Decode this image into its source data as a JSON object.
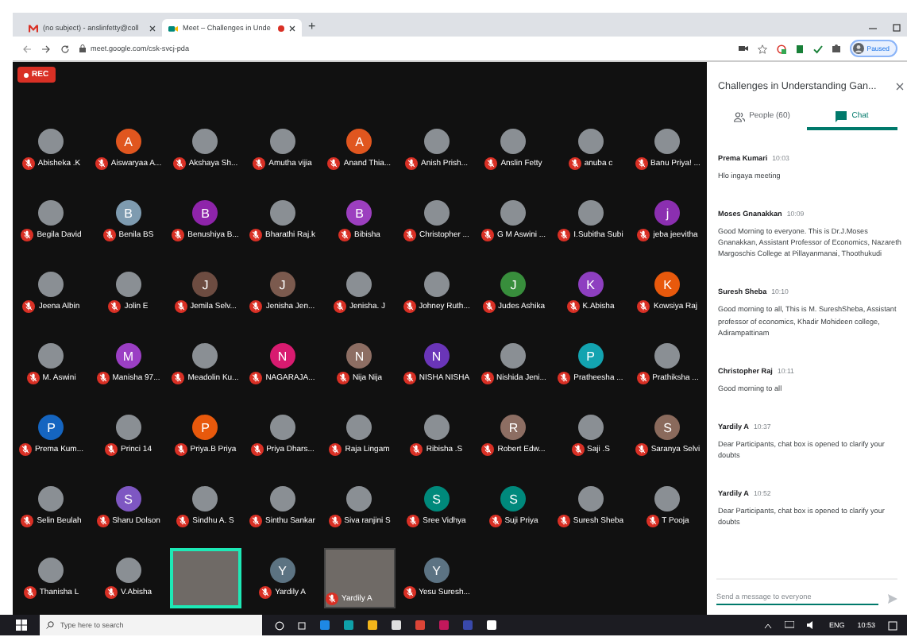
{
  "browser": {
    "tabs": [
      {
        "title": "(no subject) - anslinfetty@coll",
        "kind": "mail",
        "selected": false,
        "recording": false
      },
      {
        "title": "Meet – Challenges in Unde",
        "kind": "meet",
        "selected": true,
        "recording": true
      }
    ],
    "new_tab": "+",
    "url": "meet.google.com/csk-svcj-pda",
    "profile": "Paused"
  },
  "meeting": {
    "rec_badge": "REC",
    "participants": [
      {
        "name": "Abisheka .K",
        "kind": "photo",
        "muted": true
      },
      {
        "name": "Aiswaryaa A...",
        "kind": "letter",
        "letter": "A",
        "color": "#e0561f",
        "muted": true
      },
      {
        "name": "Akshaya Sh...",
        "kind": "photo",
        "muted": true
      },
      {
        "name": "Amutha vijia",
        "kind": "photo",
        "muted": true
      },
      {
        "name": "Anand Thia...",
        "kind": "letter",
        "letter": "A",
        "color": "#e0561f",
        "muted": true
      },
      {
        "name": "Anish Prish...",
        "kind": "photo",
        "muted": true
      },
      {
        "name": "Anslin Fetty",
        "kind": "photo",
        "muted": true
      },
      {
        "name": "anuba c",
        "kind": "photo",
        "muted": true
      },
      {
        "name": "Banu Priya! ...",
        "kind": "photo",
        "muted": true
      },
      {
        "name": "Begila David",
        "kind": "photo",
        "muted": true
      },
      {
        "name": "Benila BS",
        "kind": "letter",
        "letter": "B",
        "color": "#7e9bb0",
        "muted": true
      },
      {
        "name": "Benushiya B...",
        "kind": "letter",
        "letter": "B",
        "color": "#8e24aa",
        "muted": true
      },
      {
        "name": "Bharathi Raj.k",
        "kind": "photo",
        "muted": true
      },
      {
        "name": "Bibisha",
        "kind": "letter",
        "letter": "B",
        "color": "#9c3fbf",
        "muted": true
      },
      {
        "name": "Christopher ...",
        "kind": "photo",
        "muted": true
      },
      {
        "name": "G M Aswini ...",
        "kind": "photo",
        "muted": true
      },
      {
        "name": "I.Subitha Subi",
        "kind": "photo",
        "muted": true
      },
      {
        "name": "jeba jeevitha",
        "kind": "letter",
        "letter": "j",
        "color": "#8b2fb0",
        "muted": true
      },
      {
        "name": "Jeena Albin",
        "kind": "photo",
        "muted": true
      },
      {
        "name": "Jolin E",
        "kind": "photo",
        "muted": true
      },
      {
        "name": "Jemila Selv...",
        "kind": "letter",
        "letter": "J",
        "color": "#6d4c41",
        "muted": true
      },
      {
        "name": "Jenisha Jen...",
        "kind": "letter",
        "letter": "J",
        "color": "#7b5a4e",
        "muted": true
      },
      {
        "name": "Jenisha. J",
        "kind": "photo",
        "muted": true
      },
      {
        "name": "Johney Ruth...",
        "kind": "photo",
        "muted": true
      },
      {
        "name": "Judes Ashika",
        "kind": "letter",
        "letter": "J",
        "color": "#388e3c",
        "muted": true
      },
      {
        "name": "K.Abisha",
        "kind": "letter",
        "letter": "K",
        "color": "#8e3fc0",
        "muted": true
      },
      {
        "name": "Kowsiya Raj",
        "kind": "letter",
        "letter": "K",
        "color": "#e8590c",
        "muted": true
      },
      {
        "name": "M. Aswini",
        "kind": "photo",
        "muted": true
      },
      {
        "name": "Manisha 97...",
        "kind": "letter",
        "letter": "M",
        "color": "#9b3fc4",
        "muted": true
      },
      {
        "name": "Meadolin Ku...",
        "kind": "photo",
        "muted": true
      },
      {
        "name": "NAGARAJA...",
        "kind": "letter",
        "letter": "N",
        "color": "#d81b70",
        "muted": true
      },
      {
        "name": "Nija Nija",
        "kind": "letter",
        "letter": "N",
        "color": "#8d6e63",
        "muted": true
      },
      {
        "name": "NISHA NISHA",
        "kind": "letter",
        "letter": "N",
        "color": "#6a35b8",
        "muted": true
      },
      {
        "name": "Nishida Jeni...",
        "kind": "photo",
        "muted": true
      },
      {
        "name": "Pratheesha ...",
        "kind": "letter",
        "letter": "P",
        "color": "#13a3b0",
        "muted": true
      },
      {
        "name": "Prathiksha ...",
        "kind": "photo",
        "muted": true
      },
      {
        "name": "Prema Kum...",
        "kind": "letter",
        "letter": "P",
        "color": "#1565c0",
        "muted": true
      },
      {
        "name": "Princi 14",
        "kind": "photo",
        "muted": true
      },
      {
        "name": "Priya.B Priya",
        "kind": "letter",
        "letter": "P",
        "color": "#e8590c",
        "muted": true
      },
      {
        "name": "Priya Dhars...",
        "kind": "photo",
        "muted": true
      },
      {
        "name": "Raja Lingam",
        "kind": "photo",
        "muted": true
      },
      {
        "name": "Ribisha .S",
        "kind": "photo",
        "muted": true
      },
      {
        "name": "Robert Edw...",
        "kind": "letter",
        "letter": "R",
        "color": "#8d6e63",
        "muted": true
      },
      {
        "name": "Saji .S",
        "kind": "photo",
        "muted": true
      },
      {
        "name": "Saranya Selvi",
        "kind": "letter",
        "letter": "S",
        "color": "#8a6a5c",
        "muted": true
      },
      {
        "name": "Selin Beulah",
        "kind": "photo",
        "muted": true
      },
      {
        "name": "Sharu Dolson",
        "kind": "letter",
        "letter": "S",
        "color": "#7e57c2",
        "muted": true
      },
      {
        "name": "Sindhu A. S",
        "kind": "photo",
        "muted": true
      },
      {
        "name": "Sinthu Sankar",
        "kind": "photo",
        "muted": true
      },
      {
        "name": "Siva ranjini S",
        "kind": "photo",
        "muted": true
      },
      {
        "name": "Sree Vidhya",
        "kind": "letter",
        "letter": "S",
        "color": "#00897b",
        "muted": true
      },
      {
        "name": "Suji Priya",
        "kind": "letter",
        "letter": "S",
        "color": "#00897c",
        "muted": true
      },
      {
        "name": "Suresh Sheba",
        "kind": "photo",
        "muted": true
      },
      {
        "name": "T Pooja",
        "kind": "photo",
        "muted": true
      },
      {
        "name": "Thanisha L",
        "kind": "photo",
        "muted": true
      },
      {
        "name": "V.Abisha",
        "kind": "photo",
        "muted": true
      },
      {
        "kind": "video",
        "speaking": true
      },
      {
        "name": "Yardily A",
        "kind": "letter",
        "letter": "Y",
        "color": "#5c7382",
        "muted": true
      },
      {
        "name": "Yardily A",
        "kind": "video",
        "speaking": false,
        "muted": true
      },
      {
        "name": "Yesu Suresh...",
        "kind": "letter",
        "letter": "Y",
        "color": "#5c7383",
        "muted": true
      }
    ]
  },
  "chat_panel": {
    "title": "Challenges in Understanding Gan...",
    "tabs": [
      {
        "label": "People (60)",
        "kind": "people",
        "selected": false
      },
      {
        "label": "Chat",
        "kind": "chat",
        "selected": true
      }
    ],
    "messages": [
      {
        "sender": "Prema Kumari",
        "time": "10:03",
        "text": "Hlo ingaya meeting"
      },
      {
        "sender": "Moses Gnanakkan",
        "time": "10:09",
        "text": "Good Morning to everyone. This is Dr.J.Moses Gnanakkan, Assistant Professor of Economics, Nazareth Margoschis College at Pillayanmanai, Thoothukudi"
      },
      {
        "sender": "Suresh Sheba",
        "time": "10:10",
        "text": "Good morning to all, This is M. SureshSheba, Assistant professor of economics, Khadir Mohideen college, Adirampattinam"
      },
      {
        "sender": "Christopher Raj",
        "time": "10:11",
        "text": "Good morning to all"
      },
      {
        "sender": "Yardily A",
        "time": "10:37",
        "text": "Dear Participants, chat box is opened to clarify your doubts"
      },
      {
        "sender": "Yardily A",
        "time": "10:52",
        "text": "Dear Participants, chat box is opened to clarify your doubts"
      }
    ],
    "input": {
      "placeholder": "Send a message to everyone"
    }
  },
  "taskbar": {
    "search_placeholder": "Type here to search",
    "language": "ENG",
    "time": "10:53"
  }
}
